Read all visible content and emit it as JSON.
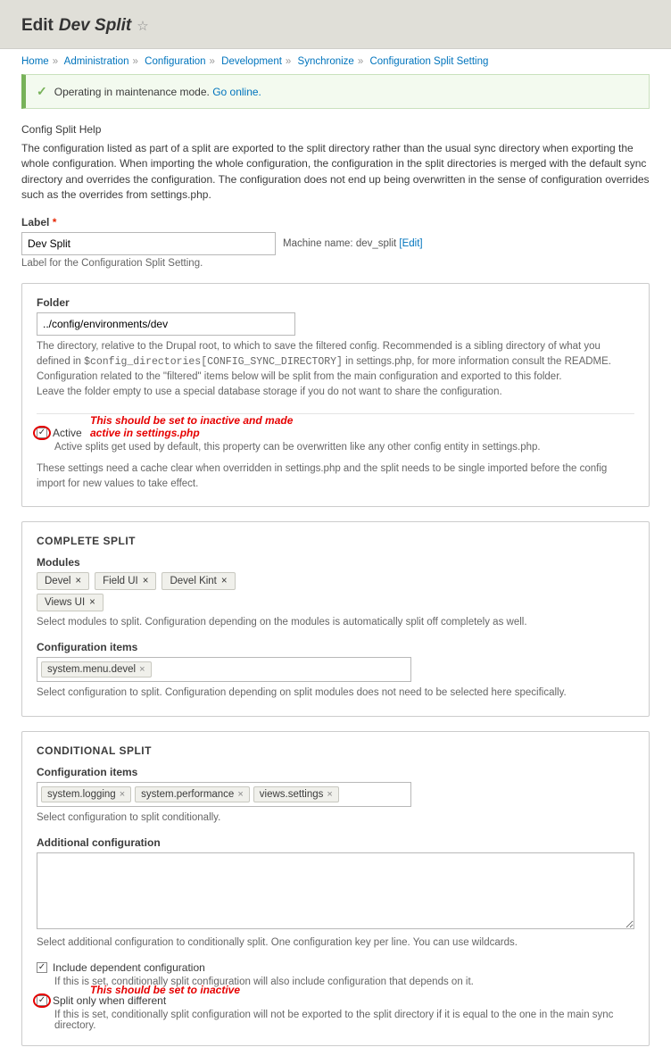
{
  "header": {
    "edit_prefix": "Edit",
    "entity_name": "Dev Split"
  },
  "breadcrumb": {
    "items": [
      "Home",
      "Administration",
      "Configuration",
      "Development",
      "Synchronize",
      "Configuration Split Setting"
    ]
  },
  "status_message": {
    "text": "Operating in maintenance mode.",
    "link_label": "Go online."
  },
  "help": {
    "title": "Config Split Help",
    "body": "The configuration listed as part of a split are exported to the split directory rather than the usual sync directory when exporting the whole configuration. When importing the whole configuration, the configuration in the split directories is merged with the default sync directory and overrides the configuration. The configuration does not end up being overwritten in the sense of configuration overrides such as the overrides from settings.php."
  },
  "label_field": {
    "label": "Label",
    "value": "Dev Split",
    "machine_name_prefix": "Machine name:",
    "machine_name": "dev_split",
    "edit_link": "[Edit]",
    "description": "Label for the Configuration Split Setting."
  },
  "folder": {
    "label": "Folder",
    "value": "../config/environments/dev",
    "desc1a": "The directory, relative to the Drupal root, to which to save the filtered config. Recommended is a sibling directory of what you defined in ",
    "desc1_code": "$config_directories[CONFIG_SYNC_DIRECTORY]",
    "desc1b": " in settings.php, for more information consult the README.",
    "desc2": "Configuration related to the \"filtered\" items below will be split from the main configuration and exported to this folder.",
    "desc3": "Leave the folder empty to use a special database storage if you do not want to share the configuration."
  },
  "active": {
    "label": "Active",
    "annotation": "This should be set to inactive and made active in settings.php",
    "desc1": "Active splits get used by default, this property can be overwritten like any other config entity in settings.php.",
    "desc2": "These settings need a cache clear when overridden in settings.php and the split needs to be single imported before the config import for new values to take effect."
  },
  "complete_split": {
    "heading": "COMPLETE SPLIT",
    "modules_label": "Modules",
    "modules": [
      "Devel",
      "Field UI",
      "Devel Kint",
      "Views UI"
    ],
    "modules_desc": "Select modules to split. Configuration depending on the modules is automatically split off completely as well.",
    "config_label": "Configuration items",
    "config_items": [
      "system.menu.devel"
    ],
    "config_desc": "Select configuration to split. Configuration depending on split modules does not need to be selected here specifically."
  },
  "conditional_split": {
    "heading": "CONDITIONAL SPLIT",
    "config_label": "Configuration items",
    "config_items": [
      "system.logging",
      "system.performance",
      "views.settings"
    ],
    "config_desc": "Select configuration to split conditionally.",
    "additional_label": "Additional configuration",
    "additional_desc": "Select additional configuration to conditionally split. One configuration key per line. You can use wildcards.",
    "include_dep_label": "Include dependent configuration",
    "include_dep_desc": "If this is set, conditionally split configuration will also include configuration that depends on it.",
    "split_diff_label": "Split only when different",
    "split_diff_annotation": "This should be set to inactive",
    "split_diff_desc": "If this is set, conditionally split configuration will not be exported to the split directory if it is equal to the one in the main sync directory."
  }
}
